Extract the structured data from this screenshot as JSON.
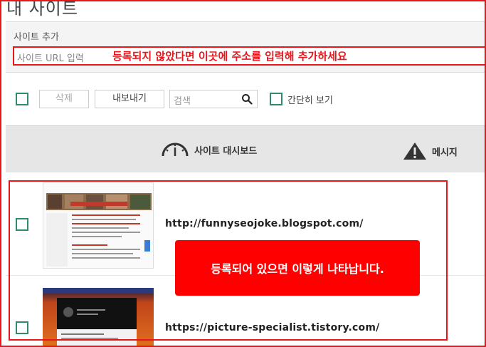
{
  "page": {
    "title": "내 사이트"
  },
  "add_site": {
    "label": "사이트 추가",
    "placeholder": "사이트 URL 입력",
    "annotation": "등록되지 않았다면 이곳에 주소를 입력해 추가하세요"
  },
  "toolbar": {
    "delete_label": "삭제",
    "export_label": "내보내기",
    "search_placeholder": "검색",
    "simple_view_label": "간단히 보기"
  },
  "header": {
    "dashboard_label": "사이트 대시보드",
    "message_label": "메시지"
  },
  "sites": [
    {
      "url": "http://funnyseojoke.blogspot.com/"
    },
    {
      "url": "https://picture-specialist.tistory.com/"
    }
  ],
  "callout": {
    "text": "등록되어 있으면 이렇게 나타납니다."
  },
  "colors": {
    "accent_red": "#e8161b",
    "checkbox_green": "#2e8b6e",
    "header_gray": "#e6e6e6"
  }
}
